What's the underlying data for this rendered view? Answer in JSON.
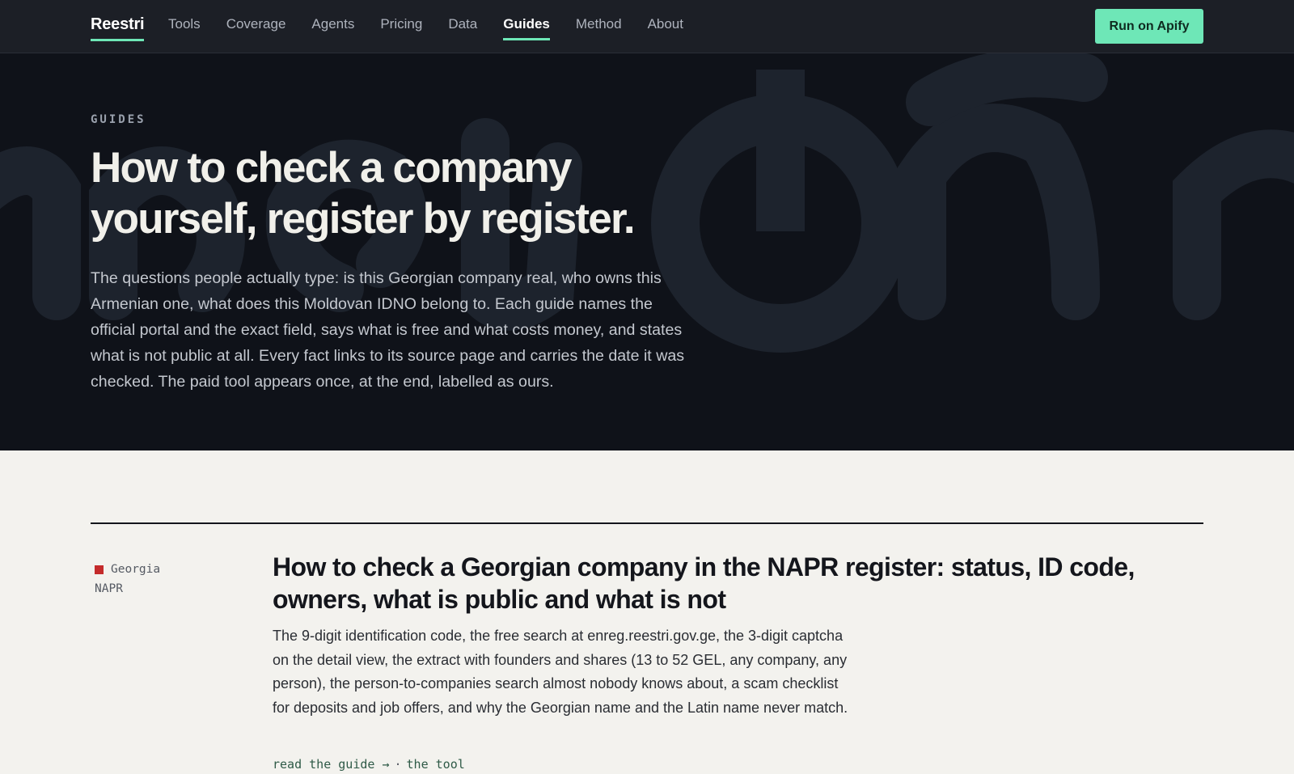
{
  "brand": "Reestri",
  "nav": {
    "items": [
      {
        "label": "Tools",
        "active": false
      },
      {
        "label": "Coverage",
        "active": false
      },
      {
        "label": "Agents",
        "active": false
      },
      {
        "label": "Pricing",
        "active": false
      },
      {
        "label": "Data",
        "active": false
      },
      {
        "label": "Guides",
        "active": true
      },
      {
        "label": "Method",
        "active": false
      },
      {
        "label": "About",
        "active": false
      }
    ],
    "cta_label": "Run on Apify"
  },
  "hero": {
    "eyebrow": "GUIDES",
    "title_line1": "How to check a company",
    "title_line2": "yourself, register by register.",
    "lead": "The questions people actually type: is this Georgian company real, who owns this Armenian one, what does this Moldovan IDNO belong to. Each guide names the official portal and the exact field, says what is free and what costs money, and states what is not public at all. Every fact links to its source page and carries the date it was checked. The paid tool appears once, at the end, labelled as ours."
  },
  "guides": [
    {
      "country": "Georgia",
      "registry": "NAPR",
      "title": "How to check a Georgian company in the NAPR register: status, ID code, owners, what is public and what is not",
      "description": "The 9-digit identification code, the free search at enreg.reestri.gov.ge, the 3-digit captcha on the detail view, the extract with founders and shares (13 to 52 GEL, any company, any person), the person-to-companies search almost nobody knows about, a scam checklist for deposits and job offers, and why the Georgian name and the Latin name never match.",
      "read_link": "read the guide →",
      "separator": "·",
      "tool_link": "the tool"
    }
  ],
  "colors": {
    "accent": "#6ee7b7",
    "topbar_bg": "#1c1f26",
    "hero_bg": "#0f1219",
    "page_bg": "#f3f2ee",
    "georgia_marker": "#c42b2b"
  }
}
